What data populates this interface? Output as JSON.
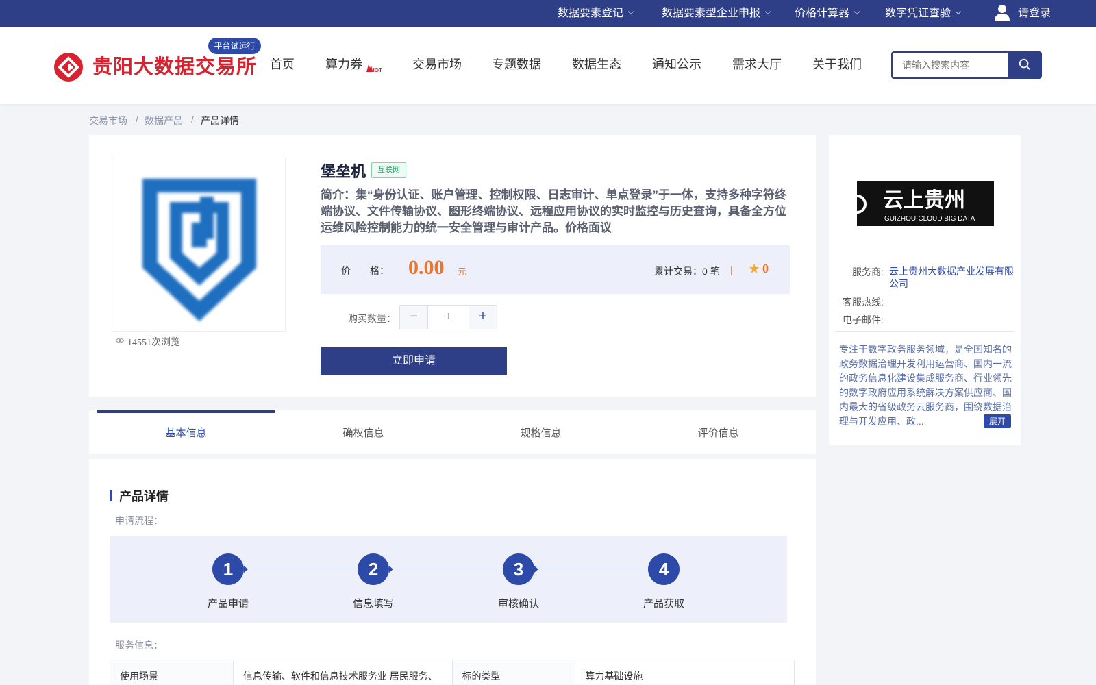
{
  "topbar": {
    "links": [
      {
        "label": "数据要素登记"
      },
      {
        "label": "数据要素型企业申报"
      },
      {
        "label": "价格计算器"
      },
      {
        "label": "数字凭证查验"
      }
    ],
    "login_label": "请登录"
  },
  "header": {
    "logo_text": "贵阳大数据交易所",
    "trial_badge": "平台试运行",
    "nav": [
      "首页",
      "算力券",
      "交易市场",
      "专题数据",
      "数据生态",
      "通知公示",
      "需求大厅",
      "关于我们"
    ],
    "hot_badge": "HOT",
    "search_placeholder": "请输入搜索内容"
  },
  "breadcrumb": [
    "交易市场",
    "数据产品",
    "产品详情"
  ],
  "breadcrumb_sep": "/",
  "product": {
    "title": "堡垒机",
    "tag": "互联网",
    "intro": "简介：集“身份认证、账户管理、控制权限、日志审计、单点登录”于一体，支持多种字符终端协议、文件传输协议、图形终端协议、远程应用协议的实时监控与历史查询，具备全方位运维风险控制能力的统一安全管理与审计产品。价格面议",
    "views": "14551次浏览",
    "price_label": "价　　格：",
    "price": "0.00",
    "price_unit": "元",
    "trade_count": "累计交易：0 笔",
    "divider": "|",
    "rating": "0",
    "qty_label": "购买数量：",
    "qty": "1",
    "minus": "−",
    "plus": "+",
    "apply_label": "立即申请"
  },
  "tabs": [
    "基本信息",
    "确权信息",
    "规格信息",
    "评价信息"
  ],
  "provider": {
    "logo_text_cn": "云上贵州",
    "logo_text_en": "GUIZHOU·CLOUD BIG DATA",
    "service_label": "服务商:",
    "service_value": "云上贵州大数据产业发展有限公司",
    "hotline_label": "客服热线:",
    "email_label": "电子邮件:",
    "description": "专注于数字政务服务领域，是全国知名的政务数据治理开发利用运营商、国内一流的政务信息化建设集成服务商、行业领先的数字政府应用系统解决方案供应商、国内最大的省级政务云服务商，围绕数据治理与开发应用、政...",
    "expand_label": "展开"
  },
  "details": {
    "section_title": "产品详情",
    "flow_label": "申请流程：",
    "steps": [
      {
        "num": "1",
        "label": "产品申请"
      },
      {
        "num": "2",
        "label": "信息填写"
      },
      {
        "num": "3",
        "label": "审核确认"
      },
      {
        "num": "4",
        "label": "产品获取"
      }
    ],
    "service_info_label": "服务信息：",
    "table": [
      {
        "k1": "使用场景",
        "v1": "信息传输、软件和信息技术服务业 居民服务、",
        "k2": "标的类型",
        "v2": "算力基础设施"
      }
    ]
  },
  "colors": {
    "brand": "#2e3e87",
    "accent": "#2e4aa8",
    "price": "#e8762c",
    "logo_red": "#d6232f"
  }
}
